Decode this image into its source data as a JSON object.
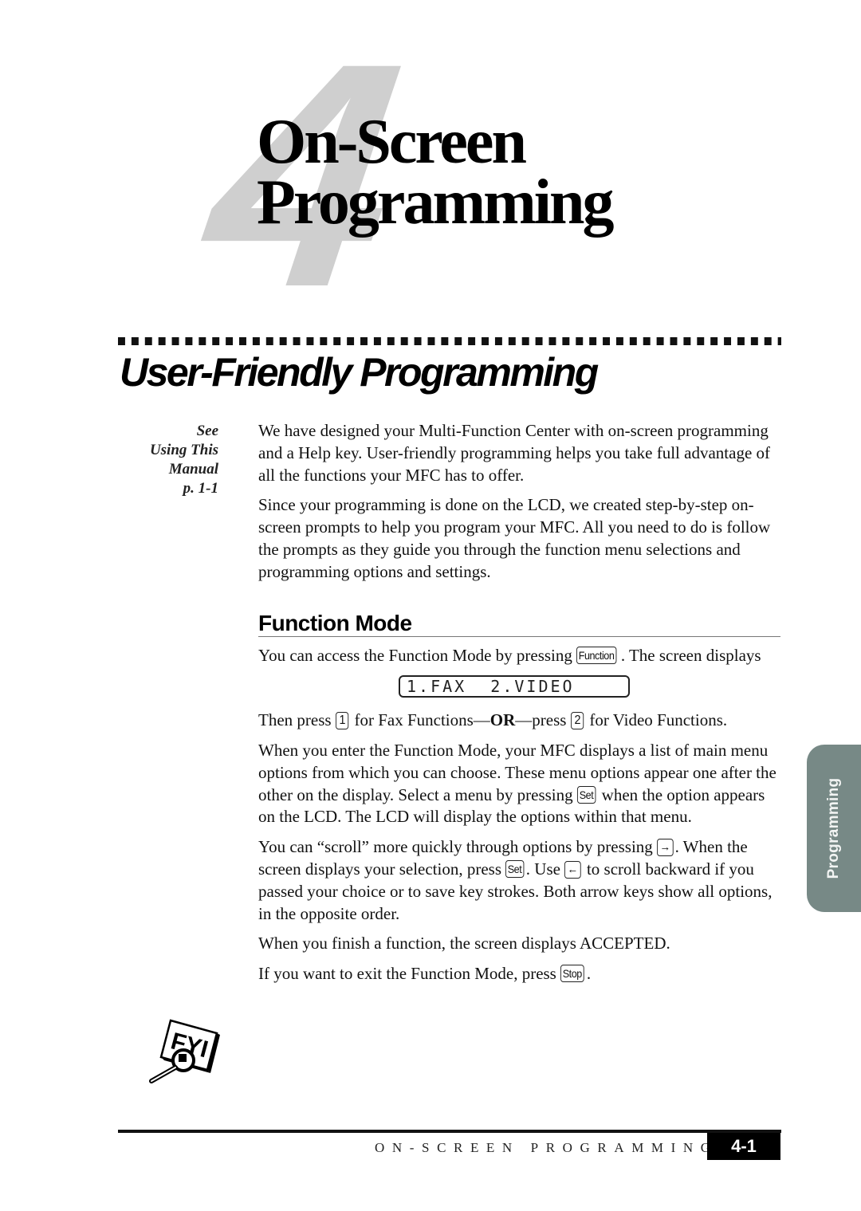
{
  "chapter": {
    "number": "4",
    "title_line1": "On-Screen",
    "title_line2": "Programming"
  },
  "section": {
    "title": "User-Friendly Programming"
  },
  "margin_note": {
    "line1": "See",
    "line2": "Using This",
    "line3": "Manual",
    "line4": "p. 1-1"
  },
  "intro": {
    "p1": "We have designed your Multi-Function Center with on-screen programming and a Help key. User-friendly programming helps you take full advantage of all the functions your MFC has to offer.",
    "p2": "Since your programming is done on the LCD, we created step-by-step on-screen prompts to help you program your MFC. All you need to do is follow the prompts as they guide you through the function menu selections and programming options and settings."
  },
  "function_mode": {
    "heading": "Function Mode",
    "p1_before": "You can access the Function Mode by pressing ",
    "p1_key": "Function",
    "p1_after": ". The screen displays",
    "lcd_text": "1.FAX  2.VIDEO",
    "p2_a": "Then press ",
    "p2_key1": "1",
    "p2_b": " for Fax Functions—",
    "p2_or": "OR",
    "p2_c": "—press ",
    "p2_key2": "2",
    "p2_d": " for Video Functions.",
    "p3_a": "When you enter the Function Mode, your MFC displays a list of main menu options from which you can choose. These menu options appear one after the other on the display. Select a menu by pressing ",
    "p3_key": "Set",
    "p3_b": " when the option appears on the LCD. The LCD will display the options within that menu.",
    "p4_a": "You can “scroll” more quickly through options by pressing ",
    "p4_key_right": "→",
    "p4_b": ". When the screen displays your selection, press ",
    "p4_key_set": "Set",
    "p4_c": ". Use ",
    "p4_key_left": "←",
    "p4_d": " to scroll backward if you passed your choice or to save key strokes. Both arrow keys show all options, in the opposite order.",
    "p5": "When you finish a function, the screen displays ACCEPTED.",
    "p6_a": "If you want to exit the Function Mode, press ",
    "p6_key": "Stop",
    "p6_b": "."
  },
  "side_tab": {
    "label": "Programming",
    "color": "#778986"
  },
  "fyi_icon": {
    "label": "FYI"
  },
  "footer": {
    "label": "ON-SCREEN PROGRAMMING",
    "page": "4-1"
  }
}
